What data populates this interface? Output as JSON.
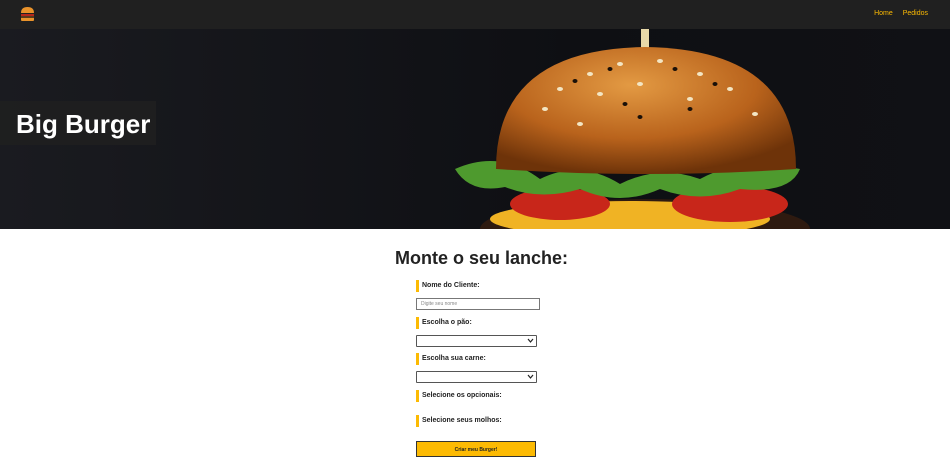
{
  "nav": {
    "home_label": "Home",
    "orders_label": "Pedidos"
  },
  "hero": {
    "title": "Big Burger"
  },
  "form": {
    "title": "Monte o seu lanche:",
    "client_name_label": "Nome do Cliente:",
    "client_name_placeholder": "Digite seu nome",
    "bread_label": "Escolha o pão:",
    "meat_label": "Escolha sua carne:",
    "optionals_label": "Selecione os opcionais:",
    "sauces_label": "Selecione seus molhos:",
    "submit_label": "Criar meu Burger!"
  },
  "colors": {
    "accent": "#FCBA03",
    "nav_bg": "#202020",
    "hero_bg": "#111216"
  }
}
